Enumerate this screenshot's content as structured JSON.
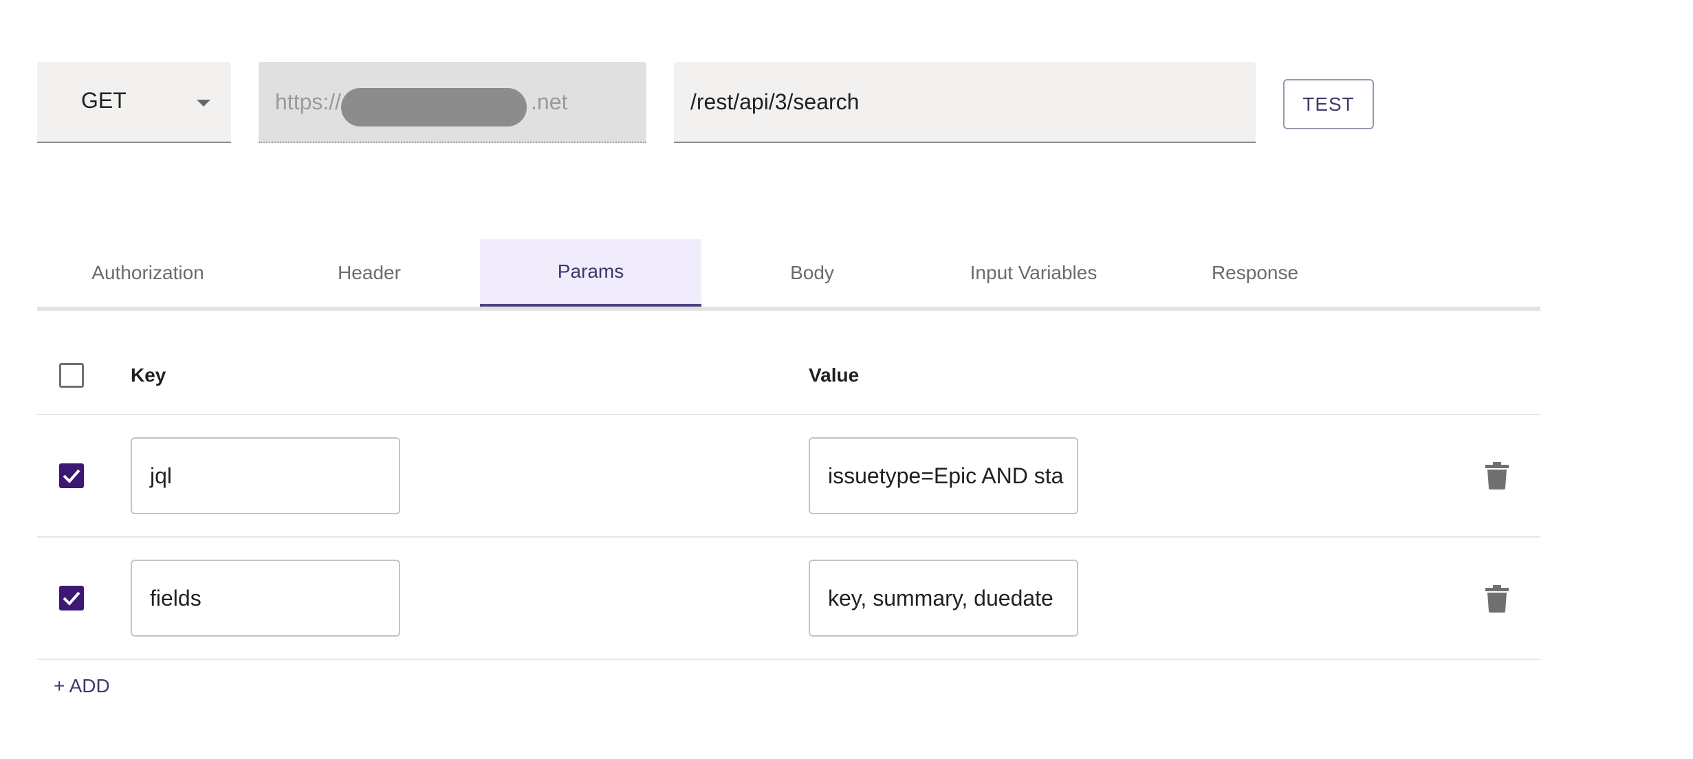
{
  "request": {
    "method": "GET",
    "base_url_prefix": "https://",
    "base_url_suffix": ".net",
    "path": "/rest/api/3/search",
    "test_label": "TEST"
  },
  "tabs": [
    {
      "label": "Authorization",
      "active": false
    },
    {
      "label": "Header",
      "active": false
    },
    {
      "label": "Params",
      "active": true
    },
    {
      "label": "Body",
      "active": false
    },
    {
      "label": "Input Variables",
      "active": false
    },
    {
      "label": "Response",
      "active": false
    }
  ],
  "params": {
    "key_header": "Key",
    "value_header": "Value",
    "select_all_checked": false,
    "rows": [
      {
        "checked": true,
        "key": "jql",
        "value": "issuetype=Epic AND sta"
      },
      {
        "checked": true,
        "key": "fields",
        "value": "key, summary, duedate"
      }
    ],
    "add_label": "+ ADD"
  },
  "colors": {
    "accent": "#3d1774",
    "active_tab_bg": "#f1ecfc",
    "button_text": "#3e3a6e"
  },
  "icons": {
    "method_dropdown": "chevron-down-icon",
    "row_delete": "trash-icon",
    "checkbox": "check-icon"
  }
}
